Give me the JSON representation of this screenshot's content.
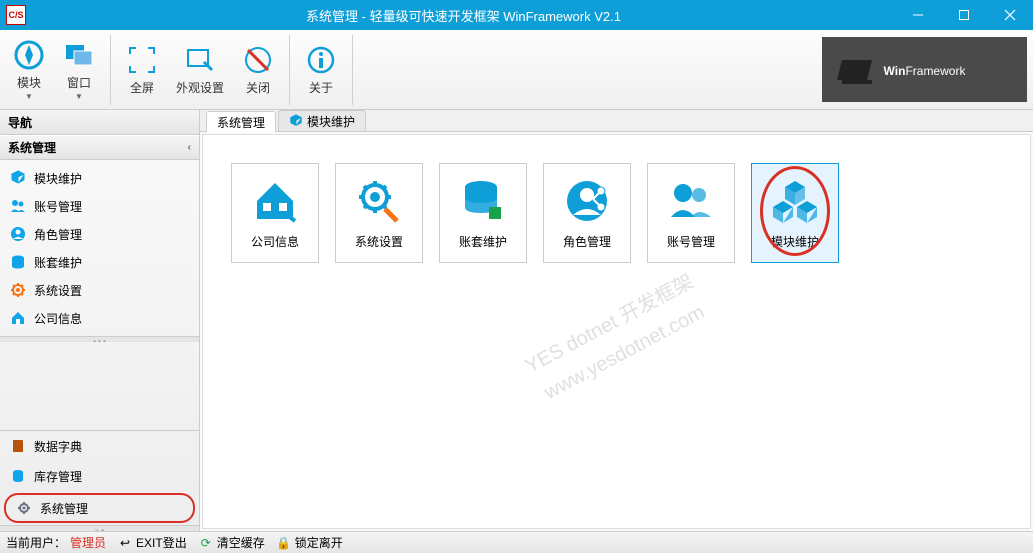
{
  "title": "系统管理 - 轻量级可快速开发框架 WinFramework V2.1",
  "app_icon_text": "C/S",
  "toolbar": {
    "module": "模块",
    "window": "窗口",
    "fullscreen": "全屏",
    "appearance": "外观设置",
    "close": "关闭",
    "about": "关于"
  },
  "brand_bold": "Win",
  "brand_light": "Framework",
  "sidebar": {
    "nav_header": "导航",
    "section": "系统管理",
    "items": [
      {
        "label": "模块维护",
        "icon": "module",
        "color": "#0ea5e9"
      },
      {
        "label": "账号管理",
        "icon": "users",
        "color": "#0ea5e9"
      },
      {
        "label": "角色管理",
        "icon": "user-circle",
        "color": "#0ea5e9"
      },
      {
        "label": "账套维护",
        "icon": "db",
        "color": "#0ea5e9"
      },
      {
        "label": "系统设置",
        "icon": "settings-orange",
        "color": "#f97316"
      },
      {
        "label": "公司信息",
        "icon": "home",
        "color": "#0ea5e9"
      }
    ],
    "bottom": [
      {
        "label": "数据字典",
        "icon": "book",
        "color": "#b45309"
      },
      {
        "label": "库存管理",
        "icon": "inventory",
        "color": "#0ea5e9"
      },
      {
        "label": "系统管理",
        "icon": "gear",
        "color": "#6b7280",
        "active": true
      }
    ]
  },
  "tabs": [
    {
      "label": "系统管理",
      "active": true
    },
    {
      "label": "模块维护",
      "active": false
    }
  ],
  "tiles": [
    {
      "label": "公司信息",
      "icon": "home"
    },
    {
      "label": "系统设置",
      "icon": "settings"
    },
    {
      "label": "账套维护",
      "icon": "db"
    },
    {
      "label": "角色管理",
      "icon": "user-share"
    },
    {
      "label": "账号管理",
      "icon": "users"
    },
    {
      "label": "模块维护",
      "icon": "cubes",
      "selected": true
    }
  ],
  "watermark": "YES dotnet 开发框架\nwww.yesdotnet.com",
  "statusbar": {
    "current_user_label": "当前用户：",
    "current_user": "管理员",
    "exit": "EXIT登出",
    "clear_cache": "清空缓存",
    "lock_away": "锁定离开"
  }
}
